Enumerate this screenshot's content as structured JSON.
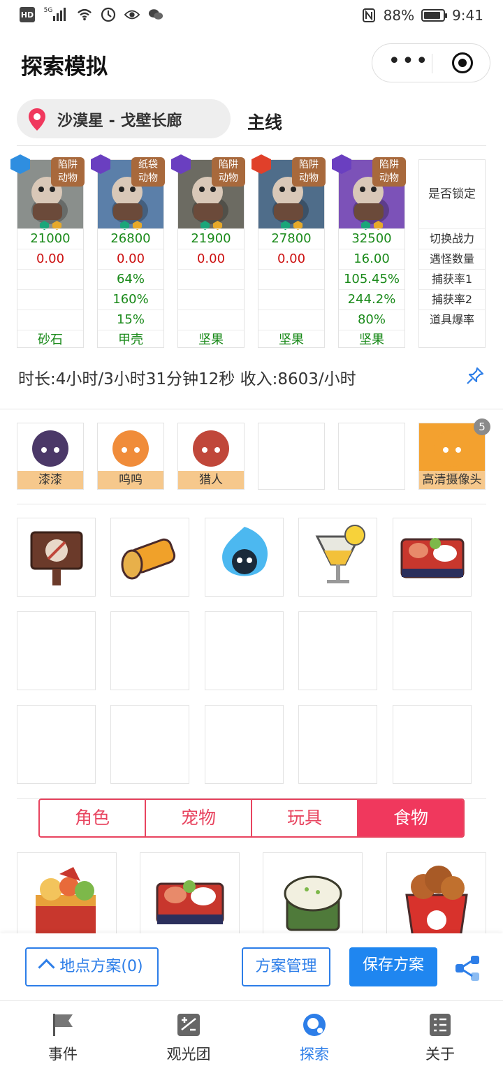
{
  "status_bar": {
    "network_label": "HD",
    "signal_label": "5G",
    "battery_percent": "88%",
    "battery_level": 0.88,
    "time": "9:41"
  },
  "header": {
    "title": "探索模拟",
    "more_icon": "more-icon",
    "target_icon": "target-icon"
  },
  "location": {
    "name": "沙漠星 - 戈壁长廊",
    "mode": "主线"
  },
  "characters": [
    {
      "element": "water",
      "tag": "陷阱\n动物",
      "power": "21000",
      "encounter": "0.00",
      "capture1": "",
      "capture2": "",
      "drop": "",
      "item": "砂石",
      "bg": "#8a8f8c"
    },
    {
      "element": "moon",
      "tag": "纸袋\n动物",
      "power": "26800",
      "encounter": "0.00",
      "capture1": "64%",
      "capture2": "160%",
      "drop": "15%",
      "item": "甲壳",
      "bg": "#5b7fa9"
    },
    {
      "element": "moon",
      "tag": "陷阱\n动物",
      "power": "21900",
      "encounter": "0.00",
      "capture1": "",
      "capture2": "",
      "drop": "",
      "item": "坚果",
      "bg": "#6c6b62"
    },
    {
      "element": "fire",
      "tag": "陷阱\n动物",
      "power": "27800",
      "encounter": "0.00",
      "capture1": "",
      "capture2": "",
      "drop": "",
      "item": "坚果",
      "bg": "#4f6d8a"
    },
    {
      "element": "moon",
      "tag": "陷阱\n动物",
      "power": "32500",
      "encounter": "16.00",
      "capture1": "105.45%",
      "capture2": "244.2%",
      "drop": "80%",
      "item": "坚果",
      "bg": "#7c52b8"
    }
  ],
  "stat_labels": {
    "lock": "是否锁定",
    "power": "切换战力",
    "encounter": "遇怪数量",
    "capture1": "捕获率1",
    "capture2": "捕获率2",
    "drop": "道具爆率"
  },
  "summary": "时长:4小时/3小时31分钟12秒 收入:8603/小时",
  "companions": [
    {
      "name": "漆漆",
      "color": "#4b3868"
    },
    {
      "name": "呜呜",
      "color": "#f08c3a"
    },
    {
      "name": "猎人",
      "color": "#c0473a"
    },
    {
      "name": "",
      "color": ""
    },
    {
      "name": "",
      "color": ""
    },
    {
      "name": "高清摄像头",
      "color": "#f3a12f"
    }
  ],
  "device_badge": "5",
  "items": [
    {
      "name": "no-food-sign-icon"
    },
    {
      "name": "flashlight-icon"
    },
    {
      "name": "blue-flame-skull-icon"
    },
    {
      "name": "lemon-drink-icon"
    },
    {
      "name": "bento-box-icon"
    }
  ],
  "tabs": [
    "角色",
    "宠物",
    "玩具",
    "食物"
  ],
  "active_tab": 3,
  "foods": [
    {
      "name": "festive-bento-icon"
    },
    {
      "name": "bento-box-icon"
    },
    {
      "name": "rice-cake-icon"
    },
    {
      "name": "fried-chicken-bucket-icon"
    }
  ],
  "actions": {
    "plan_location": "地点方案(0)",
    "manage": "方案管理",
    "save": "保存方案",
    "share_icon": "share-icon"
  },
  "tabbar": [
    {
      "label": "事件",
      "icon": "flag-icon"
    },
    {
      "label": "观光团",
      "icon": "calc-icon"
    },
    {
      "label": "探索",
      "icon": "explore-icon"
    },
    {
      "label": "关于",
      "icon": "list-icon"
    }
  ],
  "tabbar_active": 2
}
